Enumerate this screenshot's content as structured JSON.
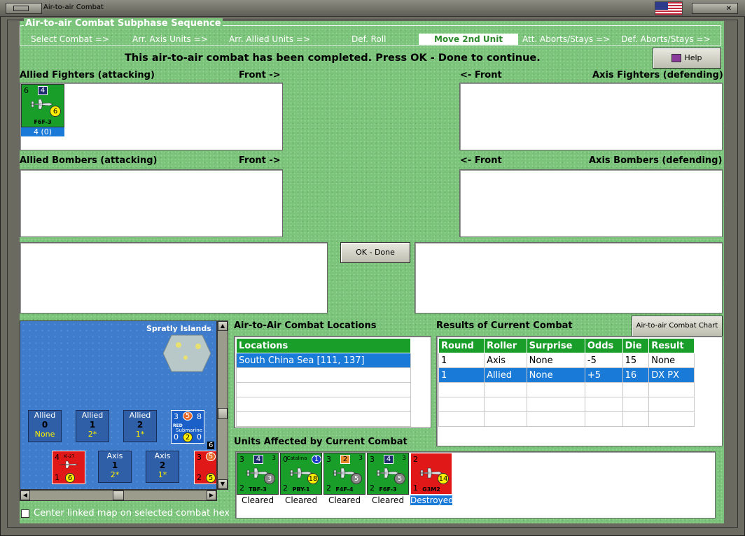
{
  "window": {
    "title": "Air-to-air Combat"
  },
  "sequence": {
    "title": "Air-to-air Combat Subphase Sequence",
    "steps": [
      "Select Combat =>",
      "Arr. Axis Units =>",
      "Arr. Allied Units =>",
      "Def. Roll",
      "Move 2nd Unit",
      "Att. Aborts/Stays =>",
      "Def. Aborts/Stays =>"
    ],
    "active_index": 4
  },
  "message": "This air-to-air combat has been completed.  Press OK - Done to continue.",
  "help_button": "Help",
  "panels": {
    "allied_fighters": "Allied Fighters (attacking)",
    "allied_fighters_front": "Front ->",
    "axis_fighters_front": "<- Front",
    "axis_fighters": "Axis Fighters (defending)",
    "allied_bombers": "Allied Bombers (attacking)",
    "allied_bombers_front": "Front ->",
    "axis_bombers_front": "<- Front",
    "axis_bombers": "Axis Bombers (defending)"
  },
  "fighter_counter": {
    "tl": "6",
    "box": "4",
    "circle": "6",
    "name": "F6F-3",
    "label": "4 (0)"
  },
  "ok_button": "OK - Done",
  "map": {
    "location_label": "Spratly Islands",
    "allied_hexes": [
      {
        "title": "Allied",
        "value": "0",
        "sub": "None"
      },
      {
        "title": "Allied",
        "value": "1",
        "sub": "2*"
      },
      {
        "title": "Allied",
        "value": "2",
        "sub": "1*"
      }
    ],
    "axis_hexes": [
      {
        "title": "Axis",
        "value": "1",
        "sub": "2*"
      },
      {
        "title": "Axis",
        "value": "2",
        "sub": "1*"
      }
    ],
    "sub_counter": {
      "tl": "3",
      "box": "5",
      "tr": "8",
      "name": "Submarine",
      "tag": "RED",
      "bl": "0",
      "circle": "2",
      "br": "0",
      "corner": "6"
    },
    "axis_counter1": {
      "tl": "4",
      "name": "Ki-27",
      "bl": "1",
      "circle": "6"
    },
    "axis_counter2": {
      "tl": "3",
      "box": "5",
      "bl": "2",
      "circle": "5"
    }
  },
  "center_checkbox": "Center linked map on selected combat hex",
  "locations": {
    "title": "Air-to-Air Combat Locations",
    "header": "Locations",
    "rows": [
      "South China Sea [111, 137]"
    ]
  },
  "results": {
    "title": "Results of Current Combat",
    "chart_button": "Air-to-air Combat Chart",
    "columns": [
      "Round",
      "Roller",
      "Surprise",
      "Odds",
      "Die",
      "Result"
    ],
    "rows": [
      [
        "1",
        "Axis",
        "None",
        "-5",
        "15",
        "None"
      ],
      [
        "1",
        "Allied",
        "None",
        "+5",
        "16",
        "DX PX"
      ]
    ]
  },
  "affected": {
    "title": "Units Affected by Current Combat",
    "units": [
      {
        "tl": "3",
        "box": "4",
        "tr": "3",
        "circle": "3",
        "bl": "2",
        "name": "TBF-3",
        "status": "Cleared",
        "color": "green",
        "circle_style": "grey"
      },
      {
        "tl": "0",
        "box": "1",
        "tr": "",
        "circle": "18",
        "bl": "2",
        "name": "PBY-1",
        "status": "Cleared",
        "color": "green",
        "circle_style": "yellow",
        "top_text": "Catalina"
      },
      {
        "tl": "3",
        "box": "2",
        "tr": "3",
        "circle": "5",
        "bl": "2",
        "name": "F4F-4",
        "status": "Cleared",
        "color": "green",
        "circle_style": "grey"
      },
      {
        "tl": "3",
        "box": "4",
        "tr": "3",
        "circle": "5",
        "bl": "2",
        "name": "F6F-3",
        "status": "Cleared",
        "color": "green",
        "circle_style": "grey"
      },
      {
        "tl": "2",
        "box": "",
        "tr": "",
        "circle": "14",
        "bl": "1",
        "name": "G3M2",
        "status": "Destroyed",
        "color": "red",
        "circle_style": "yellow"
      }
    ]
  }
}
